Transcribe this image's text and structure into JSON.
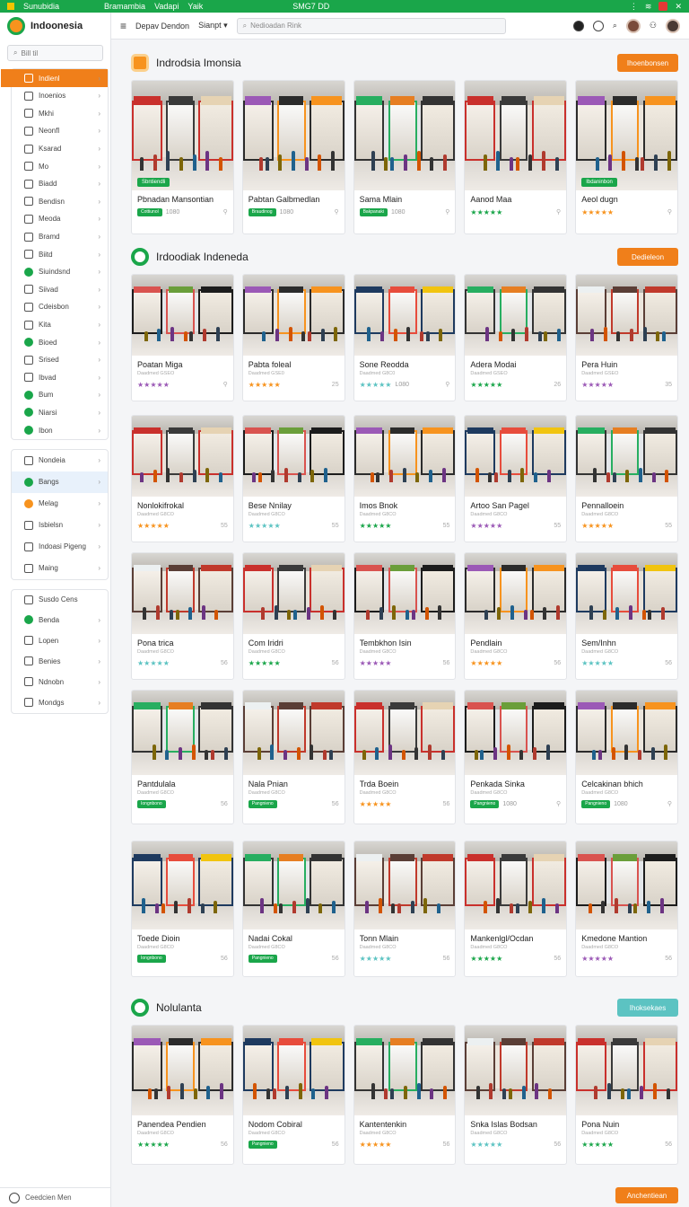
{
  "statusbar": {
    "app": "Sunubidia",
    "item2": "Bramambia",
    "item3": "Vadapi",
    "item4": "Yaik",
    "item5": "SMG7 DD"
  },
  "colors": {
    "accent_orange": "#f07f1a",
    "accent_green": "#1aa64a",
    "teal": "#5cc3c2"
  },
  "brand": {
    "name": "Indoonesia"
  },
  "sidebar": {
    "search": "Bill til",
    "items": [
      {
        "label": "Indienl",
        "icon": "grid-icon",
        "active": true
      },
      {
        "label": "Inoenios",
        "icon": "tag-icon"
      },
      {
        "label": "Mkhi",
        "icon": "list-icon"
      },
      {
        "label": "Neonfl",
        "icon": "chart-icon"
      },
      {
        "label": "Ksarad",
        "icon": "users-icon"
      },
      {
        "label": "Mo",
        "icon": "doc-icon"
      },
      {
        "label": "Biadd",
        "icon": "building-icon"
      },
      {
        "label": "Bendisn",
        "icon": "store-icon"
      },
      {
        "label": "Meoda",
        "icon": "folder-icon"
      },
      {
        "label": "Bramd",
        "icon": "calendar-icon"
      },
      {
        "label": "Biitd",
        "icon": "lock-icon"
      },
      {
        "label": "Siuindsnd",
        "icon": "leaf-icon"
      },
      {
        "label": "Siivad",
        "icon": "card-icon"
      },
      {
        "label": "Cdeisbon",
        "icon": "settings-icon"
      },
      {
        "label": "Kita",
        "icon": "cart-icon"
      },
      {
        "label": "Bioed",
        "icon": "leaf-icon"
      },
      {
        "label": "Srised",
        "icon": "clock-icon"
      },
      {
        "label": "Ibvad",
        "icon": "globe-icon"
      },
      {
        "label": "Bum",
        "icon": "leaf-icon"
      },
      {
        "label": "Niarsi",
        "icon": "leaf-icon"
      },
      {
        "label": "Ibon",
        "icon": "leaf-icon"
      }
    ],
    "group2": [
      {
        "label": "Nondeia",
        "icon": "search-icon"
      },
      {
        "label": "Bangs",
        "icon": "leaf-icon"
      },
      {
        "label": "Melag",
        "icon": "orange-ring-icon"
      },
      {
        "label": "Isbielsn",
        "icon": "box-icon"
      },
      {
        "label": "Indoasi Pigeng",
        "icon": "truck-icon"
      },
      {
        "label": "Maing",
        "icon": "tools-icon"
      }
    ],
    "group3_title": "Susdo Cens",
    "group3": [
      {
        "label": "Benda",
        "icon": "leaf-icon"
      },
      {
        "label": "Lopen",
        "icon": "image-icon"
      },
      {
        "label": "Benies",
        "icon": "doc-icon"
      },
      {
        "label": "Ndnobn",
        "icon": "window-icon"
      },
      {
        "label": "Mondgs",
        "icon": "network-icon"
      }
    ],
    "footer": "Ceedcien Men"
  },
  "topbar": {
    "item1": "Depav Dendon",
    "item2": "Sianpt",
    "search_placeholder": "Nedioadan Rink"
  },
  "sections": [
    {
      "title": "Indrodsia Imonsia",
      "button": "Ihoenbonsen",
      "rows": [
        [
          {
            "name": "Pbnadan Mansontian",
            "sub": "",
            "pill": "Cottiunol",
            "code": "1080",
            "overlay": "Sbntiendli"
          },
          {
            "name": "Pabtan Galbmedlan",
            "sub": "",
            "pill": "Braudinog",
            "code": "1080"
          },
          {
            "name": "Sama Mlain",
            "sub": "",
            "pill": "Bakpanaki",
            "code": "1080"
          },
          {
            "name": "Aanod Maa",
            "sub": "",
            "stars": "★★★★★"
          },
          {
            "name": "Aeol dugn",
            "sub": "",
            "stars": "★★★★★",
            "overlay": "Ibdaninbon"
          }
        ]
      ]
    },
    {
      "title": "Irdoodiak Indeneda",
      "button": "Dedieleon",
      "rows": [
        [
          {
            "name": "Poatan Miga",
            "sub": "Daadmed GSEO",
            "stars": "★★★★★"
          },
          {
            "name": "Pabta foleal",
            "sub": "Daadmed GSE0",
            "stars": "★★★★★",
            "mini": "25"
          },
          {
            "name": "Sone Reodda",
            "sub": "Daadmed G8C0",
            "stars": "★★★★★",
            "code": "L080"
          },
          {
            "name": "Adera Modai",
            "sub": "Daadmed GSEO",
            "stars": "★★★★★",
            "mini": "26"
          },
          {
            "name": "Pera Huin",
            "sub": "Daadmed GSEO",
            "stars": "★★★★★",
            "mini": "35"
          }
        ],
        [
          {
            "name": "Nonlokifrokal",
            "sub": "Daadmed G8CO",
            "stars": "★★★★★",
            "mini": "55"
          },
          {
            "name": "Bese Nnilay",
            "sub": "Daadmed G8CO",
            "stars": "★★★★★",
            "mini": "55"
          },
          {
            "name": "Imos Bnok",
            "sub": "Daadmed G8CO",
            "stars": "★★★★★",
            "mini": "55"
          },
          {
            "name": "Artoo San Pagel",
            "sub": "Daadmed G8CO",
            "stars": "★★★★★",
            "mini": "55"
          },
          {
            "name": "Pennalloein",
            "sub": "Daadmed G8CO",
            "stars": "★★★★★",
            "mini": "55"
          }
        ],
        [
          {
            "name": "Pona trica",
            "sub": "Daadmed G8CO",
            "stars": "★★★★★",
            "mini": "56"
          },
          {
            "name": "Com Iridri",
            "sub": "Daadmed G8CO",
            "stars": "★★★★★",
            "mini": "56"
          },
          {
            "name": "Tembkhon Isin",
            "sub": "Daadmed G8CO",
            "stars": "★★★★★",
            "mini": "56"
          },
          {
            "name": "Pendlain",
            "sub": "Daadmed G8CO",
            "stars": "★★★★★",
            "mini": "56"
          },
          {
            "name": "Sem/Inhn",
            "sub": "Daadmed G8CO",
            "stars": "★★★★★",
            "mini": "56"
          }
        ],
        [
          {
            "name": "Pantdulala",
            "sub": "Daadmed G8CO",
            "pill": "Iongnbono",
            "mini": "56"
          },
          {
            "name": "Nala Pnian",
            "sub": "Daadmed G8CO",
            "pill": "Pangnieno",
            "mini": "56"
          },
          {
            "name": "Trda Boein",
            "sub": "Daadmed G8CO",
            "stars": "★★★★★",
            "mini": "56"
          },
          {
            "name": "Penkada Sinka",
            "sub": "Daadmed G8CO",
            "pill": "Pangnieno",
            "code": "1080"
          },
          {
            "name": "Celcakinan bhich",
            "sub": "Daadmed G8CO",
            "pill": "Pangnieno",
            "code": "1080"
          }
        ],
        [
          {
            "name": "Toede Dioin",
            "sub": "Daadmed G8CO",
            "pill": "Iongnbono",
            "mini": "56"
          },
          {
            "name": "Nadai Cokal",
            "sub": "Daadmed G8CO",
            "pill": "Pangnieno",
            "mini": "56"
          },
          {
            "name": "Tonn Mlain",
            "sub": "Daadmed G8CO",
            "stars": "★★★★★",
            "mini": "56"
          },
          {
            "name": "Mankenlgl/Ocdan",
            "sub": "Daadmed G8CO",
            "stars": "★★★★★",
            "mini": "56"
          },
          {
            "name": "Kmedone Mantion",
            "sub": "Daadmed G8CO",
            "stars": "★★★★★",
            "mini": "56"
          }
        ]
      ]
    },
    {
      "title": "Nolulanta",
      "button": "Ihoksekaes",
      "rows": [
        [
          {
            "name": "Panendea Pendien",
            "sub": "Daadmed G8CO",
            "stars": "★★★★★",
            "mini": "56"
          },
          {
            "name": "Nodom Cobiral",
            "sub": "Daadmed G8CO",
            "pill": "Pangnieno",
            "mini": "56"
          },
          {
            "name": "Kantentenkin",
            "sub": "Daadmed G8CO",
            "stars": "★★★★★",
            "mini": "56"
          },
          {
            "name": "Snka Islas Bodsan",
            "sub": "Daadmed G8CO",
            "stars": "★★★★★",
            "mini": "56"
          },
          {
            "name": "Pona Nuin",
            "sub": "Daadmed G8CO",
            "stars": "★★★★★",
            "mini": "56"
          }
        ]
      ]
    }
  ],
  "footer_button": "Anchentiean"
}
